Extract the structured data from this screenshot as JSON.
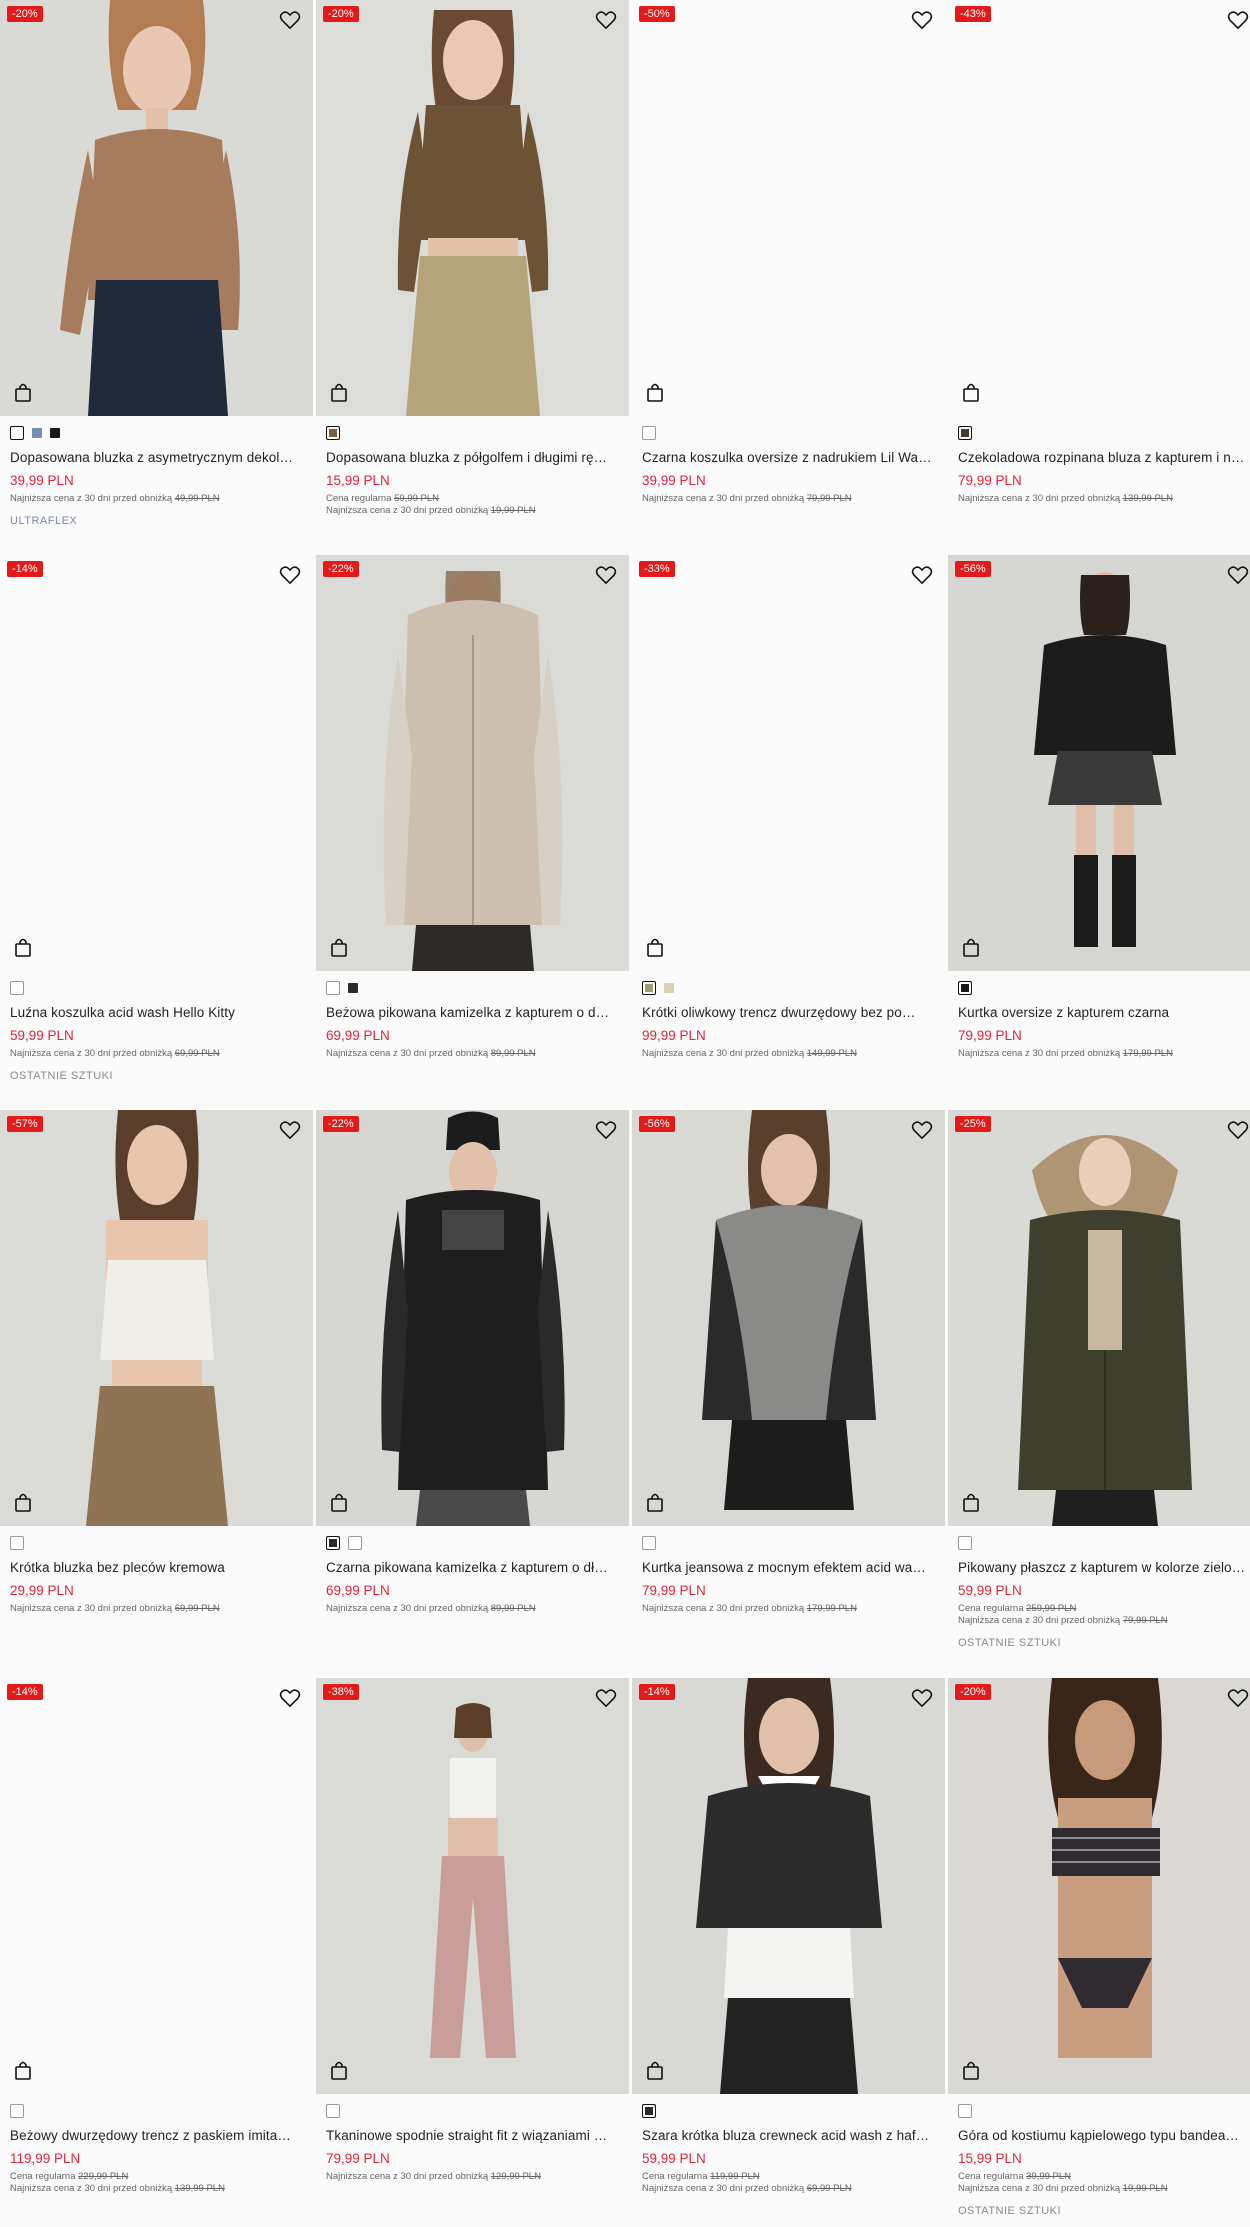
{
  "products": [
    {
      "discount": "-20%",
      "name": "Dopasowana bluzka z asymetrycznym dekol…",
      "price": "39,99 PLN",
      "regular_label": "",
      "regular_price": "",
      "lowest_label": "Najniższa cena z 30 dni przed obniżką",
      "lowest_price": "49,99 PLN",
      "tag": "ULTRAFLEX",
      "photo": "model-taupe-top",
      "swatches": [
        {
          "color": "#ffffff",
          "selected": true
        },
        {
          "color": "#6f8fb3",
          "selected": false
        },
        {
          "color": "#1a1a1a",
          "selected": false
        }
      ]
    },
    {
      "discount": "-20%",
      "name": "Dopasowana bluzka z półgolfem i długimi rę…",
      "price": "15,99 PLN",
      "regular_label": "Cena regularna",
      "regular_price": "59,99 PLN",
      "lowest_label": "Najniższa cena z 30 dni przed obniżką",
      "lowest_price": "19,99 PLN",
      "tag": "",
      "photo": "model-brown-turtleneck",
      "swatches": [
        {
          "color": "#7d5d3f",
          "selected": true
        }
      ]
    },
    {
      "discount": "-50%",
      "name": "Czarna koszulka oversize z nadrukiem Lil Wa…",
      "price": "39,99 PLN",
      "regular_label": "",
      "regular_price": "",
      "lowest_label": "Najniższa cena z 30 dni przed obniżką",
      "lowest_price": "79,99 PLN",
      "tag": "",
      "photo": "blank",
      "swatches": [
        {
          "color": "#ffffff",
          "selected": false
        }
      ]
    },
    {
      "discount": "-43%",
      "name": "Czekoladowa rozpinana bluza z kapturem i n…",
      "price": "79,99 PLN",
      "regular_label": "",
      "regular_price": "",
      "lowest_label": "Najniższa cena z 30 dni przed obniżką",
      "lowest_price": "139,99 PLN",
      "tag": "",
      "photo": "blank",
      "swatches": [
        {
          "color": "#4a3a30",
          "selected": true
        }
      ]
    },
    {
      "discount": "-14%",
      "name": "Luźna koszulka acid wash Hello Kitty",
      "price": "59,99 PLN",
      "regular_label": "",
      "regular_price": "",
      "lowest_label": "Najniższa cena z 30 dni przed obniżką",
      "lowest_price": "69,99 PLN",
      "tag": "OSTATNIE SZTUKI",
      "photo": "blank",
      "swatches": [
        {
          "color": "#ffffff",
          "selected": false
        }
      ]
    },
    {
      "discount": "-22%",
      "name": "Beżowa pikowana kamizelka z kapturem o d…",
      "price": "69,99 PLN",
      "regular_label": "",
      "regular_price": "",
      "lowest_label": "Najniższa cena z 30 dni przed obniżką",
      "lowest_price": "89,99 PLN",
      "tag": "",
      "photo": "model-beige-vest",
      "swatches": [
        {
          "color": "#ffffff",
          "selected": false
        },
        {
          "color": "#2a2a2a",
          "selected": false
        }
      ]
    },
    {
      "discount": "-33%",
      "name": "Krótki oliwkowy trencz dwurzędowy bez po…",
      "price": "99,99 PLN",
      "regular_label": "",
      "regular_price": "",
      "lowest_label": "Najniższa cena z 30 dni przed obniżką",
      "lowest_price": "149,99 PLN",
      "tag": "",
      "photo": "blank",
      "swatches": [
        {
          "color": "#a39b6e",
          "selected": true
        },
        {
          "color": "#d8d2b0",
          "selected": false
        }
      ]
    },
    {
      "discount": "-56%",
      "name": "Kurtka oversize z kapturem czarna",
      "price": "79,99 PLN",
      "regular_label": "",
      "regular_price": "",
      "lowest_label": "Najniższa cena z 30 dni przed obniżką",
      "lowest_price": "179,99 PLN",
      "tag": "",
      "photo": "model-black-jacket",
      "swatches": [
        {
          "color": "#1a1a1a",
          "selected": true
        }
      ]
    },
    {
      "discount": "-57%",
      "name": "Krótka bluzka bez pleców kremowa",
      "price": "29,99 PLN",
      "regular_label": "",
      "regular_price": "",
      "lowest_label": "Najniższa cena z 30 dni przed obniżką",
      "lowest_price": "69,99 PLN",
      "tag": "",
      "photo": "model-cream-top",
      "swatches": [
        {
          "color": "#ffffff",
          "selected": false
        }
      ]
    },
    {
      "discount": "-22%",
      "name": "Czarna pikowana kamizelka z kapturem o dł…",
      "price": "69,99 PLN",
      "regular_label": "",
      "regular_price": "",
      "lowest_label": "Najniższa cena z 30 dni przed obniżką",
      "lowest_price": "89,99 PLN",
      "tag": "",
      "photo": "model-black-vest",
      "swatches": [
        {
          "color": "#2a2a2a",
          "selected": true
        },
        {
          "color": "#ffffff",
          "selected": false
        }
      ]
    },
    {
      "discount": "-56%",
      "name": "Kurtka jeansowa z mocnym efektem acid wa…",
      "price": "79,99 PLN",
      "regular_label": "",
      "regular_price": "",
      "lowest_label": "Najniższa cena z 30 dni przed obniżką",
      "lowest_price": "179,99 PLN",
      "tag": "",
      "photo": "model-acid-jacket",
      "swatches": [
        {
          "color": "#ffffff",
          "selected": false
        }
      ]
    },
    {
      "discount": "-25%",
      "name": "Pikowany płaszcz z kapturem w kolorze zielo…",
      "price": "59,99 PLN",
      "regular_label": "Cena regularna",
      "regular_price": "259,99 PLN",
      "lowest_label": "Najniższa cena z 30 dni przed obniżką",
      "lowest_price": "79,99 PLN",
      "tag": "OSTATNIE SZTUKI",
      "photo": "model-olive-parka",
      "swatches": [
        {
          "color": "#ffffff",
          "selected": false
        }
      ]
    },
    {
      "discount": "-14%",
      "name": "Beżowy dwurzędowy trencz z paskiem imita…",
      "price": "119,99 PLN",
      "regular_label": "Cena regularna",
      "regular_price": "229,99 PLN",
      "lowest_label": "Najniższa cena z 30 dni przed obniżką",
      "lowest_price": "139,99 PLN",
      "tag": "",
      "photo": "blank",
      "swatches": [
        {
          "color": "#ffffff",
          "selected": false
        }
      ]
    },
    {
      "discount": "-38%",
      "name": "Tkaninowe spodnie straight fit z wiązaniami …",
      "price": "79,99 PLN",
      "regular_label": "",
      "regular_price": "",
      "lowest_label": "Najniższa cena z 30 dni przed obniżką",
      "lowest_price": "129,99 PLN",
      "tag": "",
      "photo": "model-pink-pants",
      "swatches": [
        {
          "color": "#ffffff",
          "selected": false
        }
      ]
    },
    {
      "discount": "-14%",
      "name": "Szara krótka bluza crewneck acid wash z haf…",
      "price": "59,99 PLN",
      "regular_label": "Cena regularna",
      "regular_price": "119,99 PLN",
      "lowest_label": "Najniższa cena z 30 dni przed obniżką",
      "lowest_price": "69,99 PLN",
      "tag": "",
      "photo": "model-grey-sweatshirt",
      "swatches": [
        {
          "color": "#2a2a2a",
          "selected": true
        }
      ]
    },
    {
      "discount": "-20%",
      "name": "Góra od kostiumu kąpielowego typu bandea…",
      "price": "15,99 PLN",
      "regular_label": "Cena regularna",
      "regular_price": "39,99 PLN",
      "lowest_label": "Najniższa cena z 30 dni przed obniżką",
      "lowest_price": "19,99 PLN",
      "tag": "OSTATNIE SZTUKI",
      "photo": "model-striped-bikini",
      "swatches": [
        {
          "color": "#ffffff",
          "selected": false
        }
      ]
    }
  ]
}
